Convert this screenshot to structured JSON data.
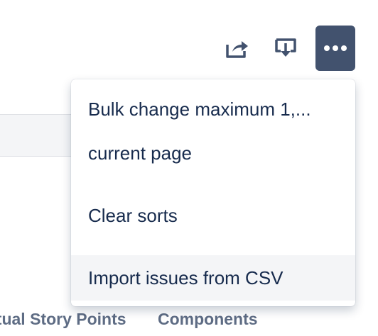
{
  "toolbar": {
    "share_icon": "share-icon",
    "export_icon": "export-icon",
    "more_icon": "more-icon",
    "more_button_color": "#42526e"
  },
  "table": {
    "column_headers": [
      "ctual Story Points",
      "Components"
    ]
  },
  "dropdown_menu": {
    "items": [
      "Bulk change maximum 1,...",
      "current page",
      "Clear sorts",
      "Import issues from CSV"
    ],
    "highlighted_item": "Import issues from CSV",
    "highlight_color": "#f4f5f7"
  }
}
